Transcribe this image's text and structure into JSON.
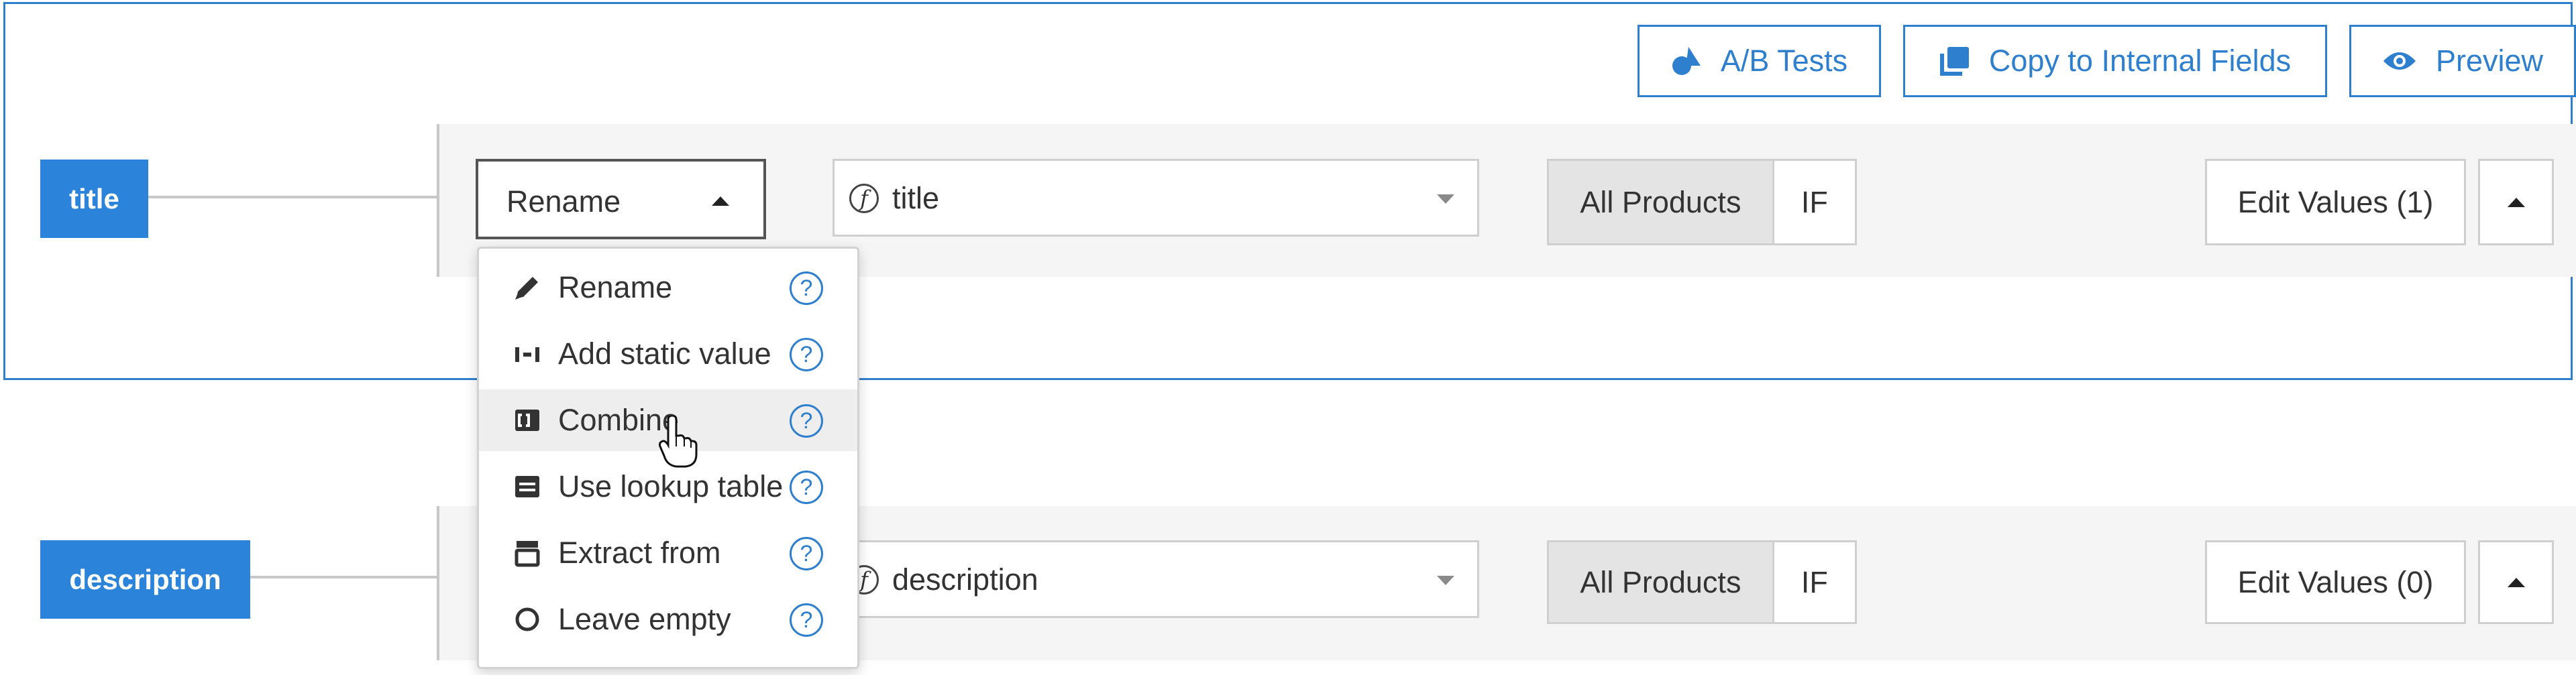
{
  "toolbar": {
    "ab_tests_label": "A/B Tests",
    "copy_label": "Copy to Internal Fields",
    "preview_label": "Preview"
  },
  "fields": [
    {
      "tag": "title",
      "action_value": "Rename",
      "source_value": "title",
      "scope_label": "All Products",
      "if_label": "IF",
      "edit_values_label": "Edit Values (1)"
    },
    {
      "tag": "description",
      "source_value": "description",
      "scope_label": "All Products",
      "if_label": "IF",
      "edit_values_label": "Edit Values (0)"
    }
  ],
  "action_menu": {
    "items": [
      {
        "label": "Rename",
        "icon": "pencil-icon"
      },
      {
        "label": "Add static value",
        "icon": "static-value-icon"
      },
      {
        "label": "Combine",
        "icon": "combine-icon"
      },
      {
        "label": "Use lookup table",
        "icon": "lookup-table-icon"
      },
      {
        "label": "Extract from",
        "icon": "extract-icon"
      },
      {
        "label": "Leave empty",
        "icon": "empty-circle-icon"
      }
    ],
    "help_glyph": "?"
  },
  "colors": {
    "accent": "#2f7fcf",
    "tag_bg": "#2b84d9",
    "row_bg": "#f5f5f5",
    "hover_bg": "#eeeeee"
  }
}
